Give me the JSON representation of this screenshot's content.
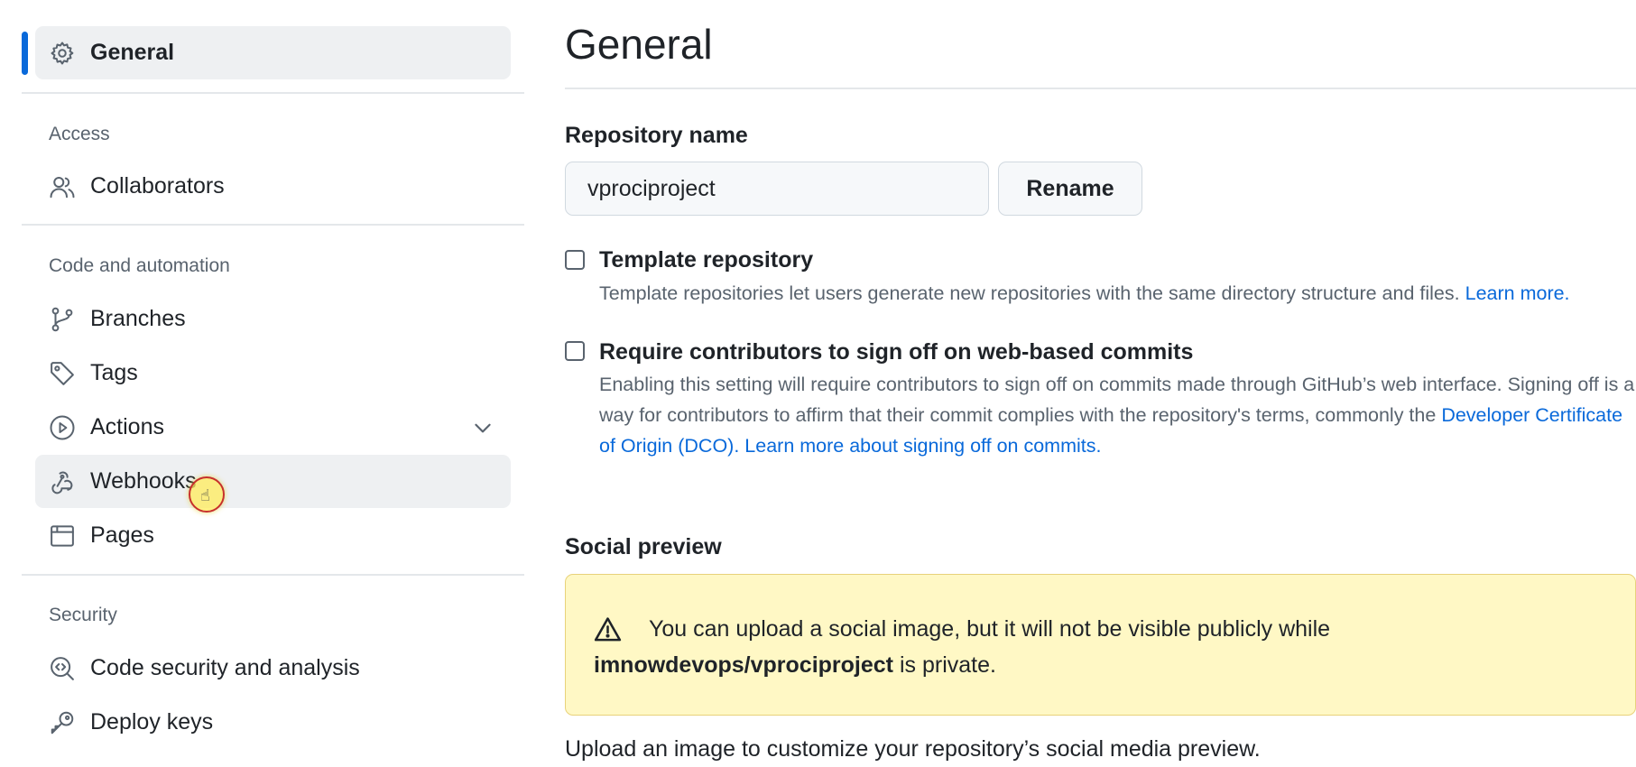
{
  "sidebar": {
    "general": {
      "label": "General",
      "icon": "gear-icon"
    },
    "sections": {
      "access": "Access",
      "code_automation": "Code and automation",
      "security": "Security"
    },
    "items": {
      "collaborators": {
        "label": "Collaborators",
        "icon": "people-icon"
      },
      "branches": {
        "label": "Branches",
        "icon": "git-branch-icon"
      },
      "tags": {
        "label": "Tags",
        "icon": "tag-icon"
      },
      "actions": {
        "label": "Actions",
        "icon": "play-icon",
        "expand_icon": "chevron-down-icon"
      },
      "webhooks": {
        "label": "Webhooks",
        "icon": "webhook-icon"
      },
      "pages": {
        "label": "Pages",
        "icon": "browser-icon"
      },
      "code_security": {
        "label": "Code security and analysis",
        "icon": "codescan-icon"
      },
      "deploy_keys": {
        "label": "Deploy keys",
        "icon": "key-icon"
      }
    },
    "accent_color": "#0969da"
  },
  "main": {
    "title": "General",
    "repo_name": {
      "label": "Repository name",
      "value": "vprociproject",
      "rename_button": "Rename"
    },
    "template": {
      "title": "Template repository",
      "desc": "Template repositories let users generate new repositories with the same directory structure and files.",
      "link": "Learn more."
    },
    "signoff": {
      "title": "Require contributors to sign off on web-based commits",
      "desc": "Enabling this setting will require contributors to sign off on commits made through GitHub’s web interface. Signing off is a way for contributors to affirm that their commit complies with the repository's terms, commonly the",
      "link1": "Developer Certificate of Origin (DCO).",
      "link2": "Learn more about signing off on commits."
    },
    "social": {
      "label": "Social preview",
      "notice_line1": "You can upload a social image, but it will not be visible publicly while",
      "notice_repo": "imnowdevops/vprociproject",
      "notice_suffix": " is private.",
      "notice_icon": "alert-icon",
      "upload_text": "Upload an image to customize your repository’s social media preview."
    }
  }
}
